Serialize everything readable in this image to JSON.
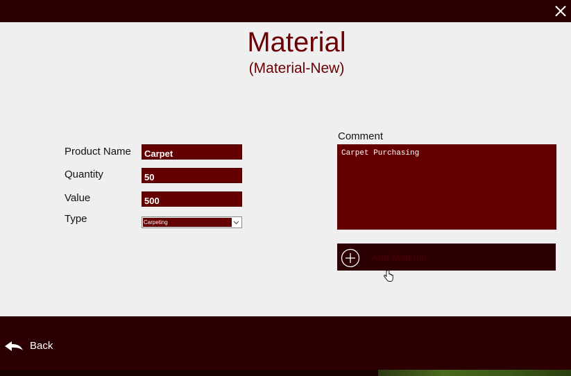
{
  "header": {
    "title": "Material",
    "subtitle": "(Material-New)"
  },
  "form": {
    "product_name_label": "Product Name",
    "product_name_value": "Carpet",
    "quantity_label": "Quantity",
    "quantity_value": "50",
    "value_label": "Value",
    "value_value": "500",
    "type_label": "Type",
    "type_selected": "Carpeting"
  },
  "comment": {
    "label": "Comment",
    "value": "Carpet Purchasing"
  },
  "actions": {
    "add_material_label": "Add Material",
    "back_label": "Back"
  },
  "colors": {
    "accent": "#640000",
    "dark": "#2c0003",
    "title": "#6b0003"
  }
}
